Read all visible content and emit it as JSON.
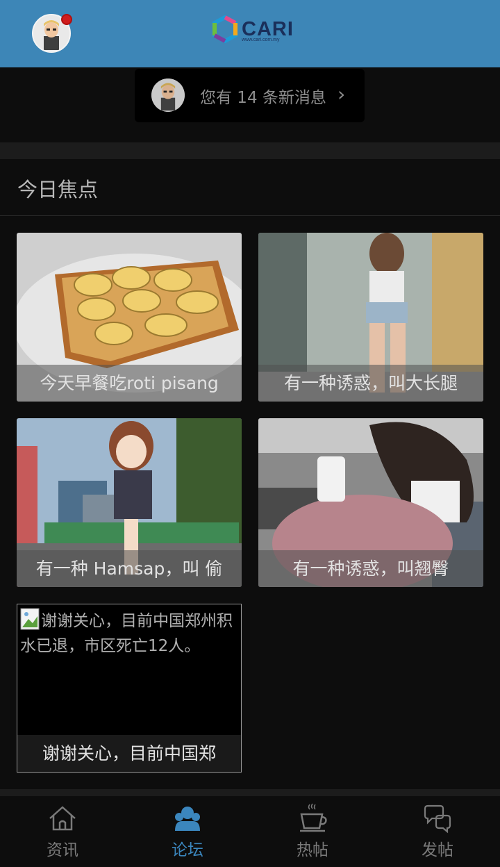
{
  "header": {
    "logo_text": "CARI",
    "logo_subtext": "www.cari.com.my"
  },
  "messages": {
    "text": "您有 14 条新消息",
    "chevron": "›"
  },
  "section": {
    "title": "今日焦点"
  },
  "cards": [
    {
      "caption": "今天早餐吃roti pisang"
    },
    {
      "caption": "有一种诱惑，叫大长腿"
    },
    {
      "caption": "有一种 Hamsap，叫 偷"
    },
    {
      "caption": "有一种诱惑，叫翘臀"
    }
  ],
  "broken_card": {
    "alt_text": "谢谢关心，目前中国郑州积水已退，市区死亡12人。",
    "caption": "谢谢关心，目前中国郑"
  },
  "bottom_nav": {
    "items": [
      {
        "label": "资讯",
        "icon": "home-icon",
        "active": false
      },
      {
        "label": "论坛",
        "icon": "community-icon",
        "active": true
      },
      {
        "label": "热帖",
        "icon": "coffee-cup-icon",
        "active": false
      },
      {
        "label": "发帖",
        "icon": "chat-bubbles-icon",
        "active": false
      }
    ]
  },
  "colors": {
    "header_bg": "#3d86b7",
    "accent": "#3b86bd",
    "notification": "#d01c1c"
  }
}
